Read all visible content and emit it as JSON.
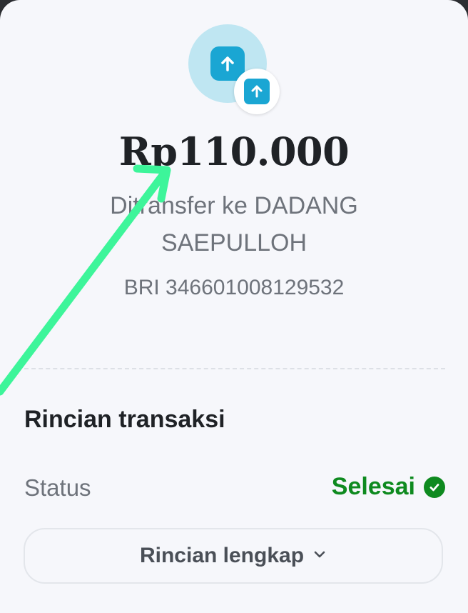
{
  "transfer": {
    "amount": "Rp110.000",
    "recipient": "Ditransfer ke DADANG SAEPULLOH",
    "account": "BRI 346601008129532"
  },
  "details": {
    "title": "Rincian transaksi",
    "status_label": "Status",
    "status_value": "Selesai",
    "full_details_label": "Rincian lengkap"
  },
  "icons": {
    "main": "transfer-out-icon",
    "badge": "transfer-out-icon",
    "status": "check-circle-icon",
    "button": "chevron-down-icon"
  },
  "colors": {
    "accent": "#1aa6d3",
    "icon_bg": "#bfe6f2",
    "success": "#0e8a1f",
    "annotation": "#3df59a"
  }
}
